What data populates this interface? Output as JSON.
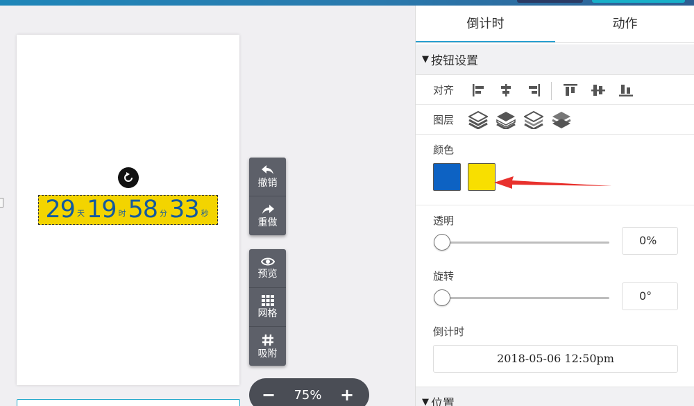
{
  "countdown": {
    "days": "29",
    "days_unit": "天",
    "hours": "19",
    "hours_unit": "时",
    "minutes": "58",
    "minutes_unit": "分",
    "seconds": "33",
    "seconds_unit": "秒",
    "background_color": "#f3d400",
    "text_color": "#135a9e"
  },
  "toolbar": {
    "undo_label": "撤销",
    "redo_label": "重做",
    "preview_label": "预览",
    "grid_label": "网格",
    "snap_label": "吸附"
  },
  "zoom": {
    "minus": "−",
    "value": "75%",
    "plus": "+"
  },
  "panel": {
    "tabs": [
      {
        "label": "倒计时",
        "active": true
      },
      {
        "label": "动作",
        "active": false
      }
    ],
    "section_button": "按钮设置",
    "align_label": "对齐",
    "align_icons": [
      "align-left-icon",
      "align-center-h-icon",
      "align-right-icon",
      "align-top-icon",
      "align-middle-v-icon",
      "align-bottom-icon"
    ],
    "layer_label": "图层",
    "layer_icons": [
      "layer-top-icon",
      "layer-up-icon",
      "layer-down-icon",
      "layer-bottom-icon"
    ],
    "color_label": "颜色",
    "colors": [
      "#0d62c3",
      "#f8df00"
    ],
    "opacity_label": "透明",
    "opacity_value": "0%",
    "rotation_label": "旋转",
    "rotation_value": "0°",
    "countdown_label": "倒计时",
    "countdown_datetime": "2018-05-06 12:50pm",
    "section_position": "位置"
  }
}
